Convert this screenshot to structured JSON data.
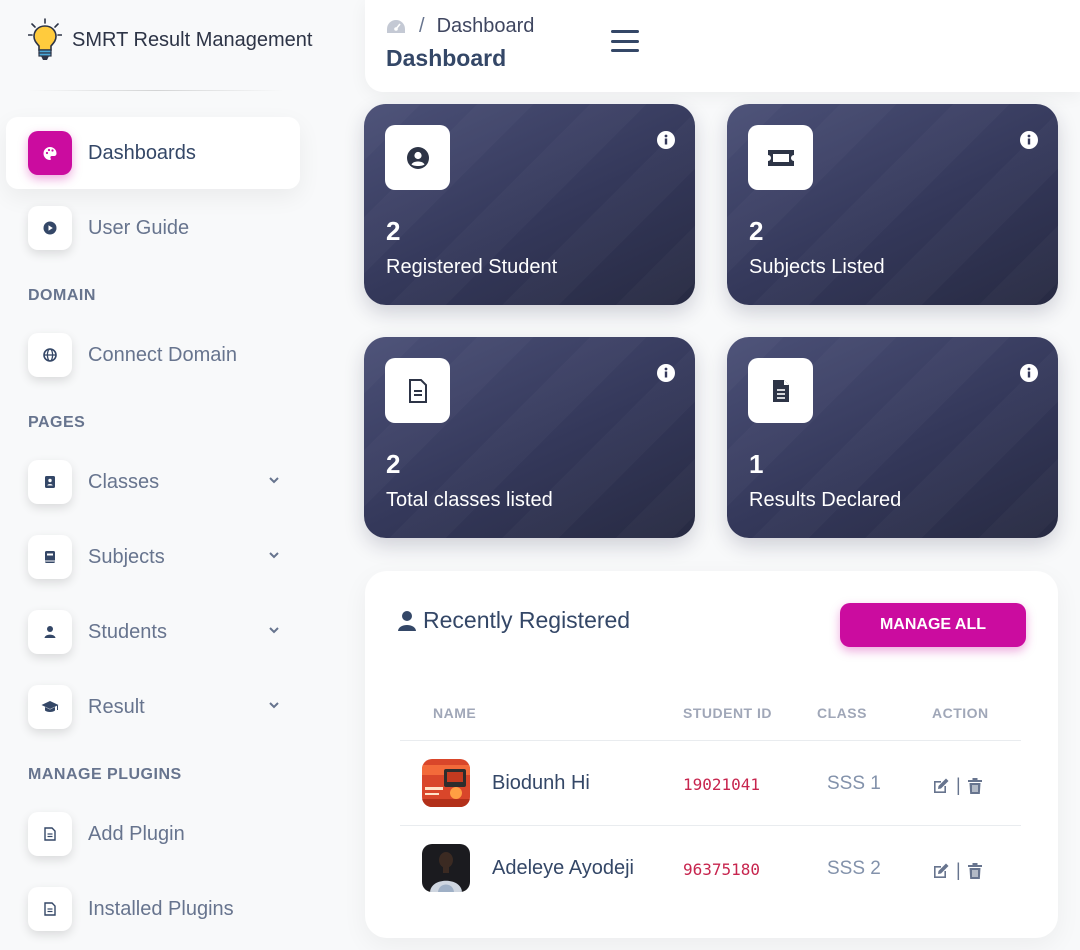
{
  "brand": {
    "name": "SMRT Result Management"
  },
  "sidebar": {
    "items": [
      {
        "label": "Dashboards",
        "icon": "palette-icon",
        "active": true
      },
      {
        "label": "User Guide",
        "icon": "play-icon"
      }
    ],
    "sections": [
      {
        "title": "DOMAIN",
        "items": [
          {
            "label": "Connect Domain",
            "icon": "globe-icon"
          }
        ]
      },
      {
        "title": "PAGES",
        "items": [
          {
            "label": "Classes",
            "icon": "address-book-icon",
            "expandable": true
          },
          {
            "label": "Subjects",
            "icon": "book-icon",
            "expandable": true
          },
          {
            "label": "Students",
            "icon": "user-icon",
            "expandable": true
          },
          {
            "label": "Result",
            "icon": "graduation-cap-icon",
            "expandable": true
          }
        ]
      },
      {
        "title": "MANAGE PLUGINS",
        "items": [
          {
            "label": "Add Plugin",
            "icon": "file-icon"
          },
          {
            "label": "Installed Plugins",
            "icon": "file-icon"
          }
        ]
      }
    ]
  },
  "header": {
    "breadcrumb": "Dashboard",
    "title": "Dashboard"
  },
  "stats": [
    {
      "value": "2",
      "label": "Registered Student",
      "icon": "user-circle-icon"
    },
    {
      "value": "2",
      "label": "Subjects Listed",
      "icon": "ticket-icon"
    },
    {
      "value": "2",
      "label": "Total classes listed",
      "icon": "file-lines-icon"
    },
    {
      "value": "1",
      "label": "Results Declared",
      "icon": "file-text-icon"
    }
  ],
  "recent": {
    "title": "Recently Registered",
    "manage_label": "MANAGE ALL",
    "columns": [
      "NAME",
      "STUDENT ID",
      "CLASS",
      "ACTION"
    ],
    "rows": [
      {
        "name": "Biodunh Hi",
        "student_id": "19021041",
        "class": "SSS 1"
      },
      {
        "name": "Adeleye Ayodeji",
        "student_id": "96375180",
        "class": "SSS 2"
      }
    ]
  },
  "colors": {
    "accent": "#cb0c9f",
    "card": "#34385a",
    "text": "#344767",
    "muted": "#67748e"
  }
}
